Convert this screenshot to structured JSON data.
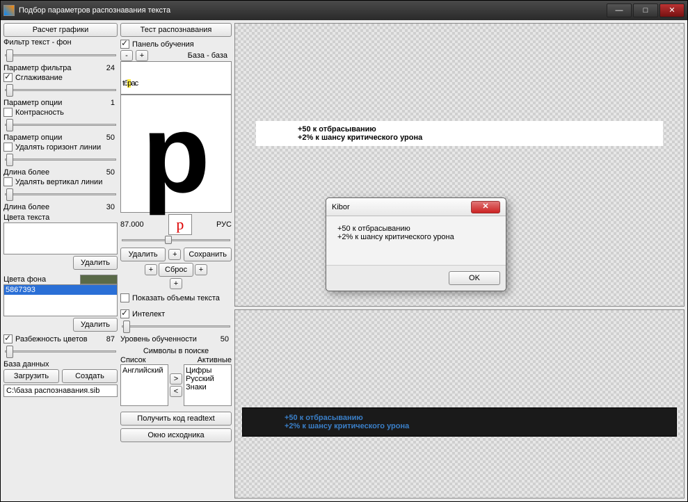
{
  "window": {
    "title": "Подбор параметров распознавания текста"
  },
  "col1": {
    "btn_calc": "Расчет графики",
    "filter_label": "Фильтр текст - фон",
    "param_filter_label": "Параметр фильтра",
    "param_filter_value": "24",
    "smoothing": "Сглаживание",
    "param_option_label1": "Параметр опции",
    "param_option_value1": "1",
    "contrast": "Контрасность",
    "param_option_label2": "Параметр опции",
    "param_option_value2": "50",
    "del_horiz": "Удалять горизонт линии",
    "len_more1_label": "Длина более",
    "len_more1_value": "50",
    "del_vert": "Удалять вертикал линии",
    "len_more2_label": "Длина более",
    "len_more2_value": "30",
    "text_colors_label": "Цвета текста",
    "btn_delete": "Удалить",
    "bg_colors_label": "Цвета фона",
    "bg_color_item": "5867393",
    "color_spread": "Разбежность цветов",
    "color_spread_value": "87",
    "db_label": "База данных",
    "btn_load": "Загрузить",
    "btn_create": "Создать",
    "db_path": "C:\\база распознавания.sib"
  },
  "col2": {
    "btn_test": "Тест распознавания",
    "panel_learning": "Панель обучения",
    "minus": "-",
    "plus": "+",
    "base_label": "База - база",
    "sample_pre": "tб",
    "sample_hl": "р",
    "sample_post": "ас",
    "big_letter": "p",
    "confidence": "87.000",
    "lang": "РУС",
    "small_letter": "р",
    "btn_del": "Удалить",
    "btn_save": "Сохранить",
    "btn_reset": "Сброс",
    "show_volumes": "Показать объемы текста",
    "intellect": "Интелект",
    "learn_level_label": "Уровень обученности",
    "learn_level_value": "50",
    "symbols_label": "Символы в поиске",
    "list_label": "Список",
    "active_label": "Активные",
    "list_item": "Английский",
    "active_items": [
      "Цифры",
      "Русский",
      "Знаки"
    ],
    "btn_get_code": "Получить код readtext",
    "btn_source": "Окно исходника"
  },
  "preview": {
    "line1": "+50 к отбрасыванию",
    "line2": "+2% к шансу критического урона"
  },
  "dialog": {
    "title": "Kibor",
    "line1": "+50 к отбрасыванию",
    "line2": "+2% к шансу критического урона",
    "ok": "OK"
  }
}
